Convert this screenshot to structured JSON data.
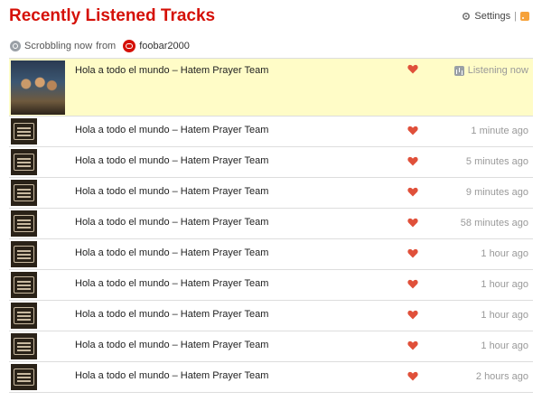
{
  "page": {
    "title": "Recently Listened Tracks"
  },
  "header_links": {
    "settings": "Settings",
    "separator": "|"
  },
  "scrobble": {
    "status": "Scrobbling now",
    "from": "from",
    "app": "foobar2000"
  },
  "tracks": [
    {
      "title": "Hola a todo el mundo – Hatem Prayer Team",
      "time": "Listening now",
      "now_playing": true
    },
    {
      "title": "Hola a todo el mundo – Hatem Prayer Team",
      "time": "1 minute ago"
    },
    {
      "title": "Hola a todo el mundo – Hatem Prayer Team",
      "time": "5 minutes ago"
    },
    {
      "title": "Hola a todo el mundo – Hatem Prayer Team",
      "time": "9 minutes ago"
    },
    {
      "title": "Hola a todo el mundo – Hatem Prayer Team",
      "time": "58 minutes ago"
    },
    {
      "title": "Hola a todo el mundo – Hatem Prayer Team",
      "time": "1 hour ago"
    },
    {
      "title": "Hola a todo el mundo – Hatem Prayer Team",
      "time": "1 hour ago"
    },
    {
      "title": "Hola a todo el mundo – Hatem Prayer Team",
      "time": "1 hour ago"
    },
    {
      "title": "Hola a todo el mundo – Hatem Prayer Team",
      "time": "1 hour ago"
    },
    {
      "title": "Hola a todo el mundo – Hatem Prayer Team",
      "time": "2 hours ago"
    }
  ],
  "icons": {
    "heart": "heart-icon",
    "settings": "gear-icon",
    "rss": "rss-icon",
    "scrobble": "scrobble-icon",
    "app": "foobar2000-icon",
    "now_playing": "equalizer-icon"
  },
  "colors": {
    "accent": "#d51007",
    "now_playing_bg": "#fffcc7",
    "heart": "#e0503a",
    "muted_text": "#999999"
  }
}
